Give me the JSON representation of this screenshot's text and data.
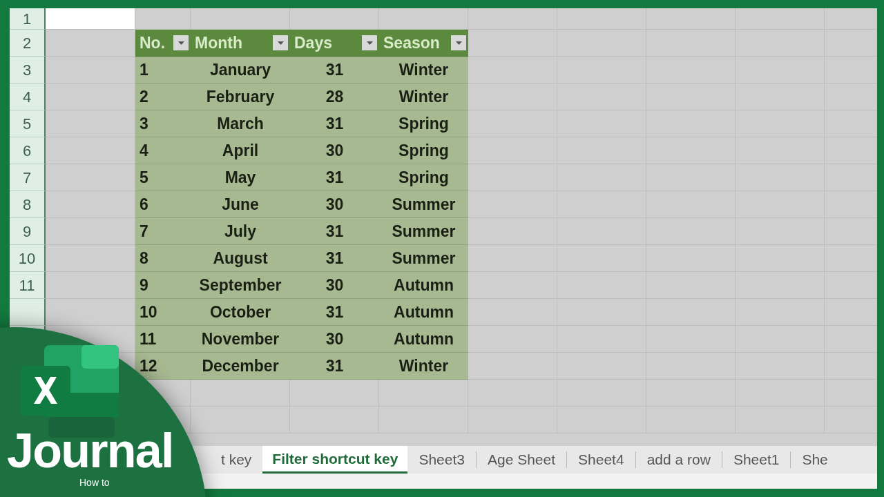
{
  "sheet": {
    "row_numbers": [
      "1",
      "2",
      "3",
      "4",
      "5",
      "6",
      "7",
      "8",
      "9",
      "10",
      "11"
    ],
    "table": {
      "columns": [
        "No.",
        "Month",
        "Days",
        "Season"
      ],
      "rows": [
        {
          "no": "1",
          "month": "January",
          "days": "31",
          "season": "Winter"
        },
        {
          "no": "2",
          "month": "February",
          "days": "28",
          "season": "Winter"
        },
        {
          "no": "3",
          "month": "March",
          "days": "31",
          "season": "Spring"
        },
        {
          "no": "4",
          "month": "April",
          "days": "30",
          "season": "Spring"
        },
        {
          "no": "5",
          "month": "May",
          "days": "31",
          "season": "Spring"
        },
        {
          "no": "6",
          "month": "June",
          "days": "30",
          "season": "Summer"
        },
        {
          "no": "7",
          "month": "July",
          "days": "31",
          "season": "Summer"
        },
        {
          "no": "8",
          "month": "August",
          "days": "31",
          "season": "Summer"
        },
        {
          "no": "9",
          "month": "September",
          "days": "30",
          "season": "Autumn"
        },
        {
          "no": "10",
          "month": "October",
          "days": "31",
          "season": "Autumn"
        },
        {
          "no": "11",
          "month": "November",
          "days": "30",
          "season": "Autumn"
        },
        {
          "no": "12",
          "month": "December",
          "days": "31",
          "season": "Winter"
        }
      ]
    }
  },
  "tabs": [
    {
      "label": "t key",
      "selected": false
    },
    {
      "label": "Filter shortcut key",
      "selected": true
    },
    {
      "label": "Sheet3",
      "selected": false
    },
    {
      "label": "Age Sheet",
      "selected": false
    },
    {
      "label": "Sheet4",
      "selected": false
    },
    {
      "label": "add a row",
      "selected": false
    },
    {
      "label": "Sheet1",
      "selected": false
    },
    {
      "label": "She",
      "selected": false
    }
  ],
  "logo": {
    "title": "Journal",
    "subtitle": "How to"
  }
}
